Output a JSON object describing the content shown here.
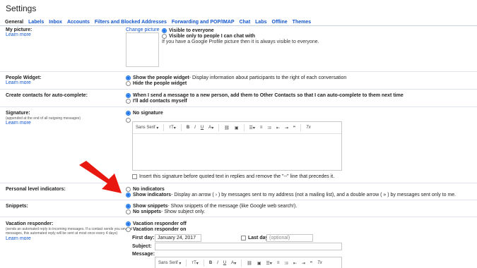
{
  "page": {
    "title": "Settings"
  },
  "tabs": [
    "General",
    "Labels",
    "Inbox",
    "Accounts",
    "Filters and Blocked Addresses",
    "Forwarding and POP/IMAP",
    "Chat",
    "Labs",
    "Offline",
    "Themes"
  ],
  "common": {
    "learn_more": "Learn more"
  },
  "my_picture": {
    "label": "My picture:",
    "change": "Change picture",
    "opt1": "Visible to everyone",
    "opt2": "Visible only to people I can chat with",
    "note": "If you have a Google Profile picture then it is always visible to everyone."
  },
  "people_widget": {
    "label": "People Widget:",
    "opt1_bold": "Show the people widget",
    "opt1_rest": " - Display information about participants to the right of each conversation",
    "opt2": "Hide the people widget"
  },
  "contacts": {
    "label": "Create contacts for auto-complete:",
    "opt1": "When I send a message to a new person, add them to Other Contacts so that I can auto-complete to them next time",
    "opt2": "I'll add contacts myself"
  },
  "signature": {
    "label": "Signature:",
    "sub": "(appended at the end of all outgoing messages)",
    "opt1": "No signature",
    "font": "Sans Serif",
    "checkbox": "Insert this signature before quoted text in replies and remove the \"--\" line that precedes it."
  },
  "toolbar": {
    "size": "тT",
    "bold": "B",
    "italic": "I",
    "underline": "U",
    "color": "A",
    "quote": "❞",
    "clear": "Tx"
  },
  "personal": {
    "label": "Personal level indicators:",
    "opt1": "No indicators",
    "opt2_bold": "Show indicators",
    "opt2_rest": " - Display an arrow ( › ) by messages sent to my address (not a mailing list), and a double arrow ( » ) by messages sent only to me."
  },
  "snippets": {
    "label": "Snippets:",
    "opt1_bold": "Show snippets",
    "opt1_rest": " - Show snippets of the message (like Google web search!).",
    "opt2_bold": "No snippets",
    "opt2_rest": " - Show subject only."
  },
  "vacation": {
    "label": "Vacation responder:",
    "sub1": "(sends an automated reply to incoming messages. If a contact sends you several",
    "sub2": "messages, this automated reply will be sent at most once every 4 days)",
    "opt1": "Vacation responder off",
    "opt2": "Vacation responder on",
    "first_day_label": "First day:",
    "first_day_value": "January 24, 2017",
    "last_day_label": "Last day:",
    "last_day_placeholder": "(optional)",
    "subject_label": "Subject:",
    "message_label": "Message:"
  },
  "colors": {
    "link": "#1155cc",
    "accent": "#1a73e8",
    "arrow": "#e8170f"
  }
}
